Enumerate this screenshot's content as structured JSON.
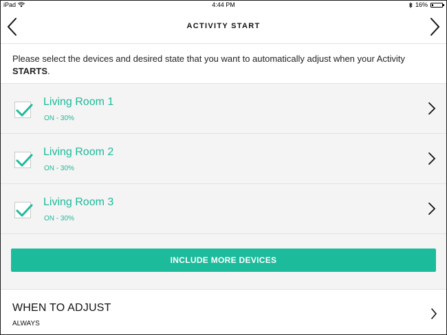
{
  "status_bar": {
    "device": "iPad",
    "time": "4:44 PM",
    "battery": "16%",
    "battery_level": 0.16,
    "icons": [
      "wifi-icon",
      "bluetooth-icon",
      "battery-icon"
    ]
  },
  "nav": {
    "title": "ACTIVITY START",
    "back_icon": "chevron-left-icon",
    "forward_icon": "chevron-right-icon"
  },
  "instruction": {
    "text": "Please select the devices and desired state that you want to automatically adjust when your Activity ",
    "emphasis": "STARTS",
    "suffix": "."
  },
  "devices": [
    {
      "name": "Living Room 1",
      "state": "ON - 30%",
      "checked": true
    },
    {
      "name": "Living Room 2",
      "state": "ON - 30%",
      "checked": true
    },
    {
      "name": "Living Room 3",
      "state": "ON - 30%",
      "checked": true
    }
  ],
  "include_button": {
    "label": "INCLUDE MORE DEVICES"
  },
  "when_to_adjust": {
    "heading": "WHEN TO ADJUST",
    "value": "ALWAYS"
  },
  "colors": {
    "accent": "#1cbb9b",
    "text": "#222222",
    "background": "#f4f4f4",
    "divider": "#e2e2e2"
  }
}
